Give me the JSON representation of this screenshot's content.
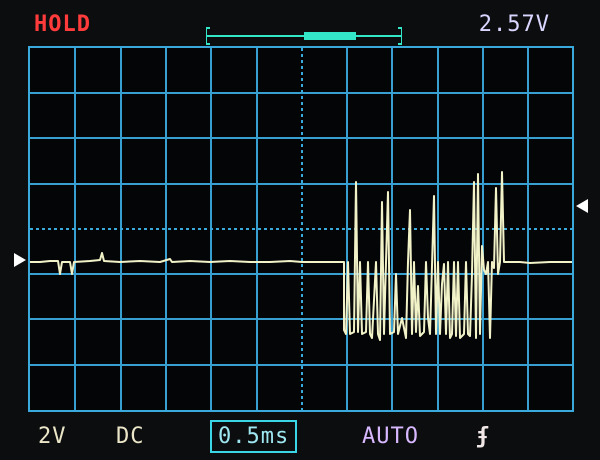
{
  "header": {
    "status": "HOLD",
    "trigger_level": "2.57V"
  },
  "footer": {
    "volts_per_div": "2V",
    "coupling": "DC",
    "timebase": "0.5ms",
    "trigger_mode": "AUTO",
    "trigger_edge": "ʄ"
  },
  "colors": {
    "status": "#ff3b3b",
    "grid": "#3aa9dc",
    "trace": "#f2f2c8",
    "timebase_box": "#3ad6e6",
    "trigger_mode": "#d8b8ff",
    "position_bar": "#33e6c8"
  },
  "icons": {
    "ground_marker": "left-triangle-marker",
    "trigger_marker": "right-triangle-marker",
    "position_indicator": "horizontal-position-bar"
  }
}
